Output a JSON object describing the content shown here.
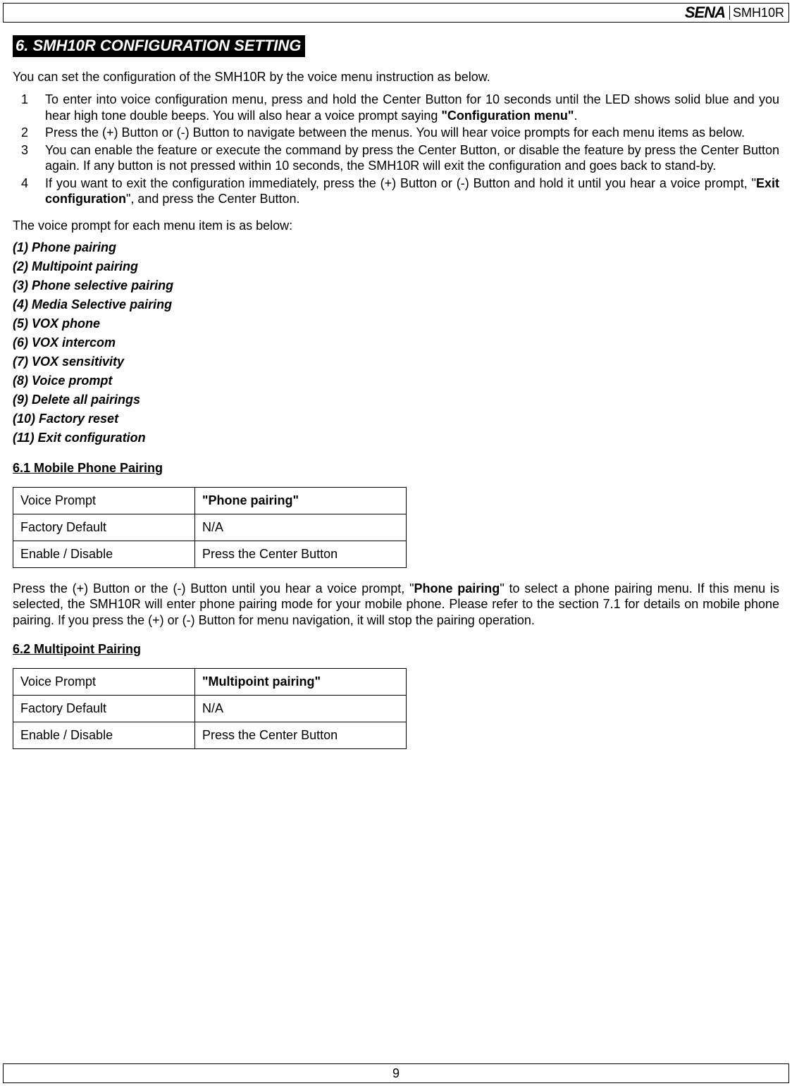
{
  "header": {
    "brand": "SENA",
    "model": "SMH10R"
  },
  "section": {
    "title": "6. SMH10R CONFIGURATION SETTING",
    "intro": "You can set the configuration of the SMH10R by the voice menu instruction as below.",
    "steps": [
      {
        "num": "1",
        "parts": [
          {
            "t": "To enter into voice configuration menu, press and hold the Center Button for 10 seconds until the LED shows solid blue and you hear high tone double beeps. You will also hear a voice prompt saying ",
            "b": false
          },
          {
            "t": "\"Configuration menu\"",
            "b": true
          },
          {
            "t": ".",
            "b": false
          }
        ]
      },
      {
        "num": "2",
        "parts": [
          {
            "t": "Press the (+) Button or (-) Button to navigate between the menus. You will hear voice prompts for each menu items as below.",
            "b": false
          }
        ]
      },
      {
        "num": "3",
        "parts": [
          {
            "t": "You can enable the feature or execute the command by press the Center Button, or disable the feature by press the Center Button again. If any button is not pressed within 10 seconds, the SMH10R will exit the configuration and goes back to stand-by.",
            "b": false
          }
        ]
      },
      {
        "num": "4",
        "parts": [
          {
            "t": "If you want to exit the configuration immediately, press the (+) Button or (-) Button and hold it until you hear a voice prompt, \"",
            "b": false
          },
          {
            "t": "Exit configuration",
            "b": true
          },
          {
            "t": "\", and press the Center Button.",
            "b": false
          }
        ]
      }
    ],
    "voice_prompt_title": "The voice prompt for each menu item is as below:",
    "menu_items": [
      "(1) Phone pairing",
      "(2) Multipoint pairing",
      "(3) Phone selective pairing",
      "(4) Media Selective pairing",
      "(5) VOX phone",
      "(6) VOX intercom",
      "(7) VOX sensitivity",
      "(8) Voice prompt",
      "(9) Delete all pairings",
      "(10) Factory reset",
      "(11) Exit configuration"
    ]
  },
  "sub_6_1": {
    "heading": "6.1 Mobile Phone Pairing",
    "rows": {
      "r1l": "Voice Prompt",
      "r1v": "\"Phone pairing\"",
      "r2l": "Factory Default",
      "r2v": "N/A",
      "r3l": "Enable / Disable",
      "r3v": "Press the Center Button"
    },
    "para_parts": [
      {
        "t": "Press the (+) Button or the (-) Button until you hear a voice prompt, \"",
        "b": false
      },
      {
        "t": "Phone pairing",
        "b": true
      },
      {
        "t": "\" to select a phone pairing menu. If this menu is selected, the SMH10R will enter phone pairing mode for your mobile phone. Please refer to the section 7.1 for details on mobile phone pairing. If you press the (+) or (-) Button for menu navigation, it will stop the pairing operation.",
        "b": false
      }
    ]
  },
  "sub_6_2": {
    "heading": "6.2 Multipoint Pairing",
    "rows": {
      "r1l": "Voice Prompt",
      "r1v": "\"Multipoint pairing\"",
      "r2l": "Factory Default",
      "r2v": "N/A",
      "r3l": "Enable / Disable",
      "r3v": "Press the Center Button"
    }
  },
  "footer": {
    "page_number": "9"
  }
}
